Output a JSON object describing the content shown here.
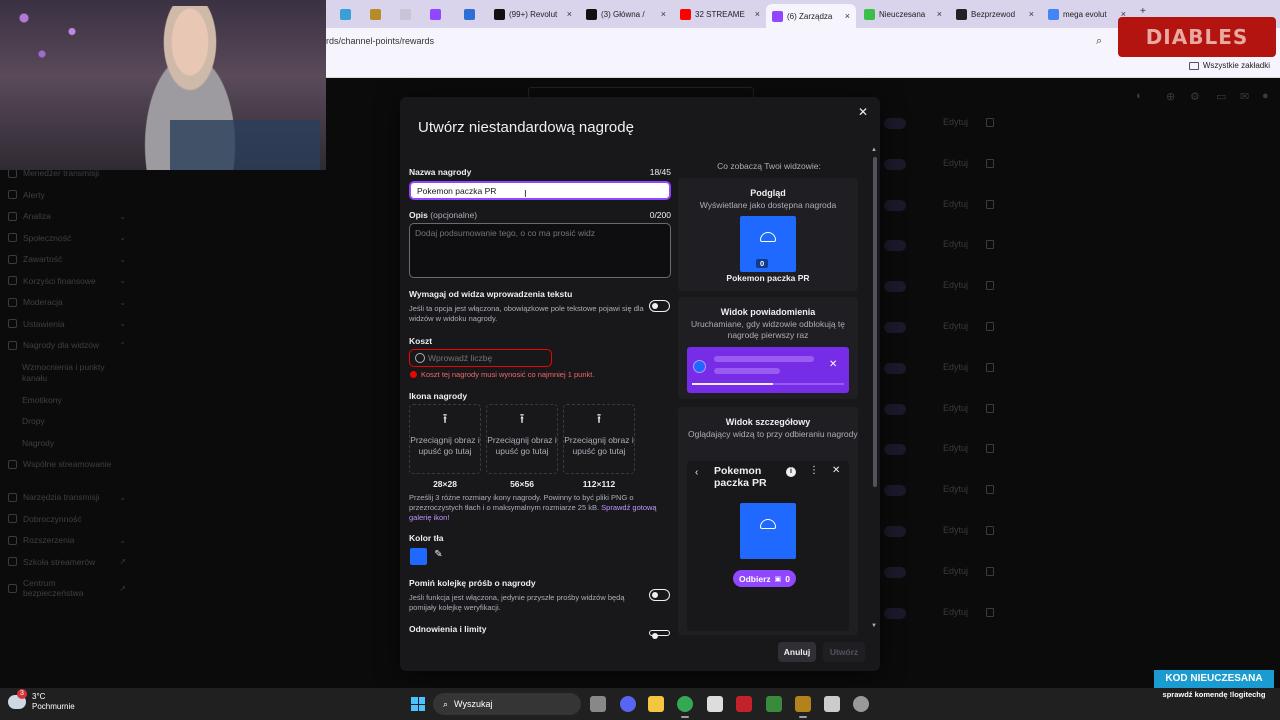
{
  "browser": {
    "tabs": [
      {
        "label": "",
        "color": "#3a9fd6"
      },
      {
        "label": "",
        "color": "#b68c2a"
      },
      {
        "label": "",
        "color": "#c9c4d6"
      },
      {
        "label": "",
        "color": "#9147ff"
      },
      {
        "label": "",
        "color": "#2e6fd6"
      },
      {
        "label": "(99+) Revolut",
        "color": "#111111"
      },
      {
        "label": "(3) Główna /",
        "color": "#111111"
      },
      {
        "label": "32 STREAME",
        "color": "#ff0000"
      },
      {
        "label": "(6) Zarządza",
        "color": "#9147ff"
      },
      {
        "label": "Nieuczesana",
        "color": "#3cbf4a"
      },
      {
        "label": "Bezprzewod",
        "color": "#222222"
      },
      {
        "label": "mega evolut",
        "color": "#4285f4"
      }
    ],
    "url": "rds/channel-points/rewards",
    "bookmarks_folder": "Wszystkie zakładki",
    "overlay_logo": "DIABLES"
  },
  "sidebar": {
    "items": [
      {
        "label": "Menedżer transmisji",
        "chev": ""
      },
      {
        "label": "Alerty",
        "chev": ""
      },
      {
        "label": "Analiza",
        "chev": "⌄"
      },
      {
        "label": "Społeczność",
        "chev": "⌄"
      },
      {
        "label": "Zawartość",
        "chev": "⌄"
      },
      {
        "label": "Korzyści finansowe",
        "chev": "⌄"
      },
      {
        "label": "Moderacja",
        "chev": "⌄"
      },
      {
        "label": "Ustawienia",
        "chev": "⌄"
      },
      {
        "label": "Nagrody dla widzów",
        "chev": "⌃"
      }
    ],
    "sub_items": [
      "Wzmocnienia i punkty kanału",
      "Emotikony",
      "Dropy",
      "Nagrody"
    ],
    "items2": [
      {
        "label": "Wspólne streamowanie",
        "chev": ""
      },
      {
        "label": "Narzędzia transmisji",
        "chev": "⌄"
      },
      {
        "label": "Dobroczynność",
        "chev": ""
      },
      {
        "label": "Rozszerzenia",
        "chev": "⌄"
      },
      {
        "label": "Szkoła streamerów",
        "chev": "↗"
      },
      {
        "label": "Centrum bezpieczeństwa",
        "chev": "↗"
      }
    ],
    "edit_label": "Edytuj"
  },
  "modal": {
    "title": "Utwórz niestandardową nagrodę",
    "name_label": "Nazwa nagrody",
    "name_counter": "18/45",
    "name_value": "Pokemon paczka PR",
    "desc_label": "Opis",
    "desc_optional": "(opcjonalne)",
    "desc_counter": "0/200",
    "desc_placeholder": "Dodaj podsumowanie tego, o co ma prosić widz",
    "require_text_label": "Wymagaj od widza wprowadzenia tekstu",
    "require_text_help": "Jeśli ta opcja jest włączona, obowiązkowe pole tekstowe pojawi się dla widzów w widoku nagrody.",
    "cost_label": "Koszt",
    "cost_placeholder": "Wprowadź liczbę",
    "cost_error": "Koszt tej nagrody musi wynosić co najmniej 1 punkt.",
    "icon_label": "Ikona nagrody",
    "upload_text": "Przeciągnij obraz i upuść go tutaj",
    "sizes": [
      "28×28",
      "56×56",
      "112×112"
    ],
    "icon_help": "Prześlij 3 różne rozmiary ikony nagrody. Powinny to być pliki PNG o przezroczystych tłach i o maksymalnym rozmiarze 25 kB.",
    "icon_help_link": "Sprawdź gotową galerię ikon!",
    "bg_color_label": "Kolor tła",
    "bg_color": "#1f69ff",
    "skip_queue_label": "Pomiń kolejkę próśb o nagrody",
    "skip_queue_help": "Jeśli funkcja jest włączona, jedynie przyszłe prośby widzów będą pomijały kolejkę weryfikacji.",
    "cooldown_label": "Odnowienia i limity",
    "cancel_label": "Anuluj",
    "create_label": "Utwórz",
    "close_icon": "close-icon"
  },
  "preview": {
    "heading": "Co zobaczą Twoi widzowie:",
    "preview_title": "Podgląd",
    "preview_sub": "Wyświetlane jako dostępna nagroda",
    "reward_name": "Pokemon paczka PR",
    "cost_value": "0",
    "notif_title": "Widok powiadomienia",
    "notif_sub": "Uruchamiane, gdy widzowie odblokują tę nagrodę pierwszy raz",
    "notif_progress": 0.53,
    "detail_title": "Widok szczegółowy",
    "detail_sub": "Oglądający widzą to przy odbieraniu nagrody",
    "detail_reward": "Pokemon paczka PR",
    "redeem_label": "Odbierz",
    "redeem_cost": "0"
  },
  "taskbar": {
    "temp": "3°C",
    "weather": "Pochmurnie",
    "search": "Wyszukaj"
  },
  "stream_overlay": {
    "code_title": "KOD NIEUCZESANA",
    "code_sub": "sprawdź komendę !logitechg"
  }
}
